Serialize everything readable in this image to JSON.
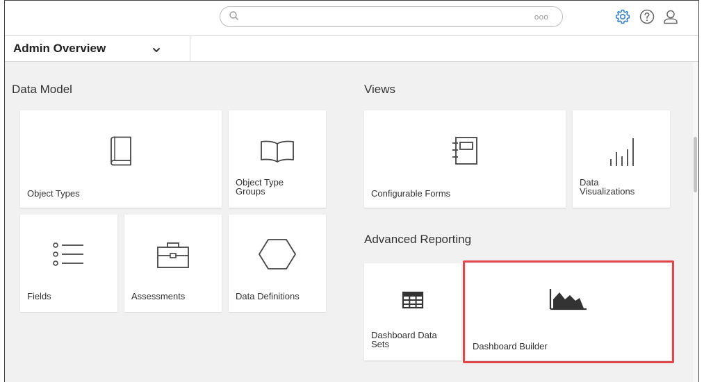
{
  "header": {
    "search": {
      "placeholder": "",
      "more_dots": "ooo"
    },
    "icons": [
      "gear-icon",
      "help-icon",
      "user-icon"
    ],
    "accent_color": "#2b7bd1"
  },
  "nav": {
    "selected_view": "Admin Overview"
  },
  "sections": {
    "data_model": {
      "title": "Data Model",
      "tiles": [
        {
          "label": "Object Types",
          "icon": "book-icon"
        },
        {
          "label_line1": "Object Type",
          "label_line2": "Groups",
          "icon": "open-book-icon"
        },
        {
          "label": "Fields",
          "icon": "list-icon"
        },
        {
          "label": "Assessments",
          "icon": "briefcase-icon"
        },
        {
          "label": "Data Definitions",
          "icon": "hexagon-icon"
        }
      ]
    },
    "views": {
      "title": "Views",
      "tiles": [
        {
          "label": "Configurable Forms",
          "icon": "form-icon"
        },
        {
          "label_line1": "Data",
          "label_line2": "Visualizations",
          "icon": "bar-chart-icon"
        }
      ]
    },
    "advanced_reporting": {
      "title": "Advanced Reporting",
      "tiles": [
        {
          "label_line1": "Dashboard Data",
          "label_line2": "Sets",
          "icon": "table-grid-icon"
        },
        {
          "label": "Dashboard Builder",
          "icon": "area-chart-icon",
          "highlighted": true
        }
      ],
      "highlight_color": "#e0474c"
    }
  }
}
